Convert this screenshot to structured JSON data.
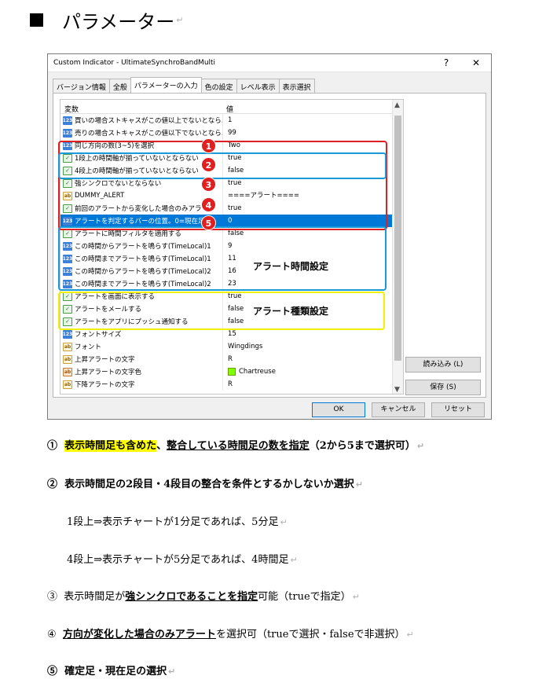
{
  "page": {
    "title": "パラメーター",
    "para_mark": "↵"
  },
  "dialog": {
    "title": "Custom Indicator - UltimateSynchroBandMulti",
    "help": "?",
    "close": "✕",
    "tabs": [
      "バージョン情報",
      "全般",
      "パラメーターの入力",
      "色の設定",
      "レベル表示",
      "表示選択"
    ],
    "active_tab": 2,
    "columns": [
      "変数",
      "値"
    ],
    "rows": [
      {
        "icon": "num",
        "name": "買いの場合ストキャスがこの値以上でないとなら…",
        "value": "1"
      },
      {
        "icon": "num",
        "name": "売りの場合ストキャスがこの値以下でないとなら…",
        "value": "99"
      },
      {
        "icon": "num",
        "name": "同じ方向の数(3~5)を選択",
        "value": "Two"
      },
      {
        "icon": "bool",
        "name": "1段上の時間軸が揃っていないとならない",
        "value": "true"
      },
      {
        "icon": "bool",
        "name": "4段上の時間軸が揃っていないとならない",
        "value": "false"
      },
      {
        "icon": "bool",
        "name": "強シンクロでないとならない",
        "value": "true"
      },
      {
        "icon": "str",
        "name": "DUMMY_ALERT",
        "value": "====アラート===="
      },
      {
        "icon": "bool",
        "name": "前回のアラートから変化した場合のみアラート",
        "value": "true"
      },
      {
        "icon": "num",
        "name": "アラートを判定するバーの位置。0=現在足",
        "value": "0",
        "selected": true
      },
      {
        "icon": "bool",
        "name": "アラートに時間フィルタを適用する",
        "value": "false"
      },
      {
        "icon": "num",
        "name": "この時間からアラートを鳴らす(TimeLocal)1",
        "value": "9"
      },
      {
        "icon": "num",
        "name": "この時間までアラートを鳴らす(TimeLocal)1",
        "value": "11"
      },
      {
        "icon": "num",
        "name": "この時間からアラートを鳴らす(TimeLocal)2",
        "value": "16"
      },
      {
        "icon": "num",
        "name": "この時間までアラートを鳴らす(TimeLocal)2",
        "value": "23"
      },
      {
        "icon": "bool",
        "name": "アラートを画面に表示する",
        "value": "true"
      },
      {
        "icon": "bool",
        "name": "アラートをメールする",
        "value": "false"
      },
      {
        "icon": "bool",
        "name": "アラートをアプリにプッシュ通知する",
        "value": "false"
      },
      {
        "icon": "num",
        "name": "フォントサイズ",
        "value": "15"
      },
      {
        "icon": "str",
        "name": "フォント",
        "value": "Wingdings"
      },
      {
        "icon": "str",
        "name": "上昇アラートの文字",
        "value": "R"
      },
      {
        "icon": "col",
        "name": "上昇アラートの文字色",
        "value": "Chartreuse",
        "swatch": "#7fff00"
      },
      {
        "icon": "str",
        "name": "下降アラートの文字",
        "value": "R"
      }
    ],
    "load_button": "読み込み (L)",
    "save_button": "保存 (S)",
    "ok_button": "OK",
    "cancel_button": "キャンセル",
    "reset_button": "リセット"
  },
  "annotations": {
    "alert_time": "アラート時間設定",
    "alert_type": "アラート種類設定",
    "badges": [
      "1",
      "2",
      "3",
      "4",
      "5"
    ],
    "red": "#e02020",
    "blue": "#1a9ad6",
    "yellow": "#f0f000"
  },
  "notes": {
    "n1_num": "①",
    "n1_hl": "表示時間足も含めた",
    "n1_sep": "、",
    "n1_u": "整合している時間足の数を指定",
    "n1_tail": "（2から5まで選択可）",
    "n2_num": "②",
    "n2_text": "表示時間足の2段目・4段目の整合を条件とするかしないか選択",
    "n2a": "1段上⇒表示チャートが1分足であれば、5分足",
    "n2b": "4段上⇒表示チャートが5分足であれば、4時間足",
    "n3_num": "③",
    "n3_pre": "表示時間足が",
    "n3_u": "強シンクロであることを指定",
    "n3_tail": "可能（trueで指定）",
    "n4_num": "④",
    "n4_u": "方向が変化した場合のみアラート",
    "n4_tail": "を選択可（trueで選択・falseで非選択）",
    "n5_num": "⑤",
    "n5_text": "確定足・現在足の選択"
  }
}
